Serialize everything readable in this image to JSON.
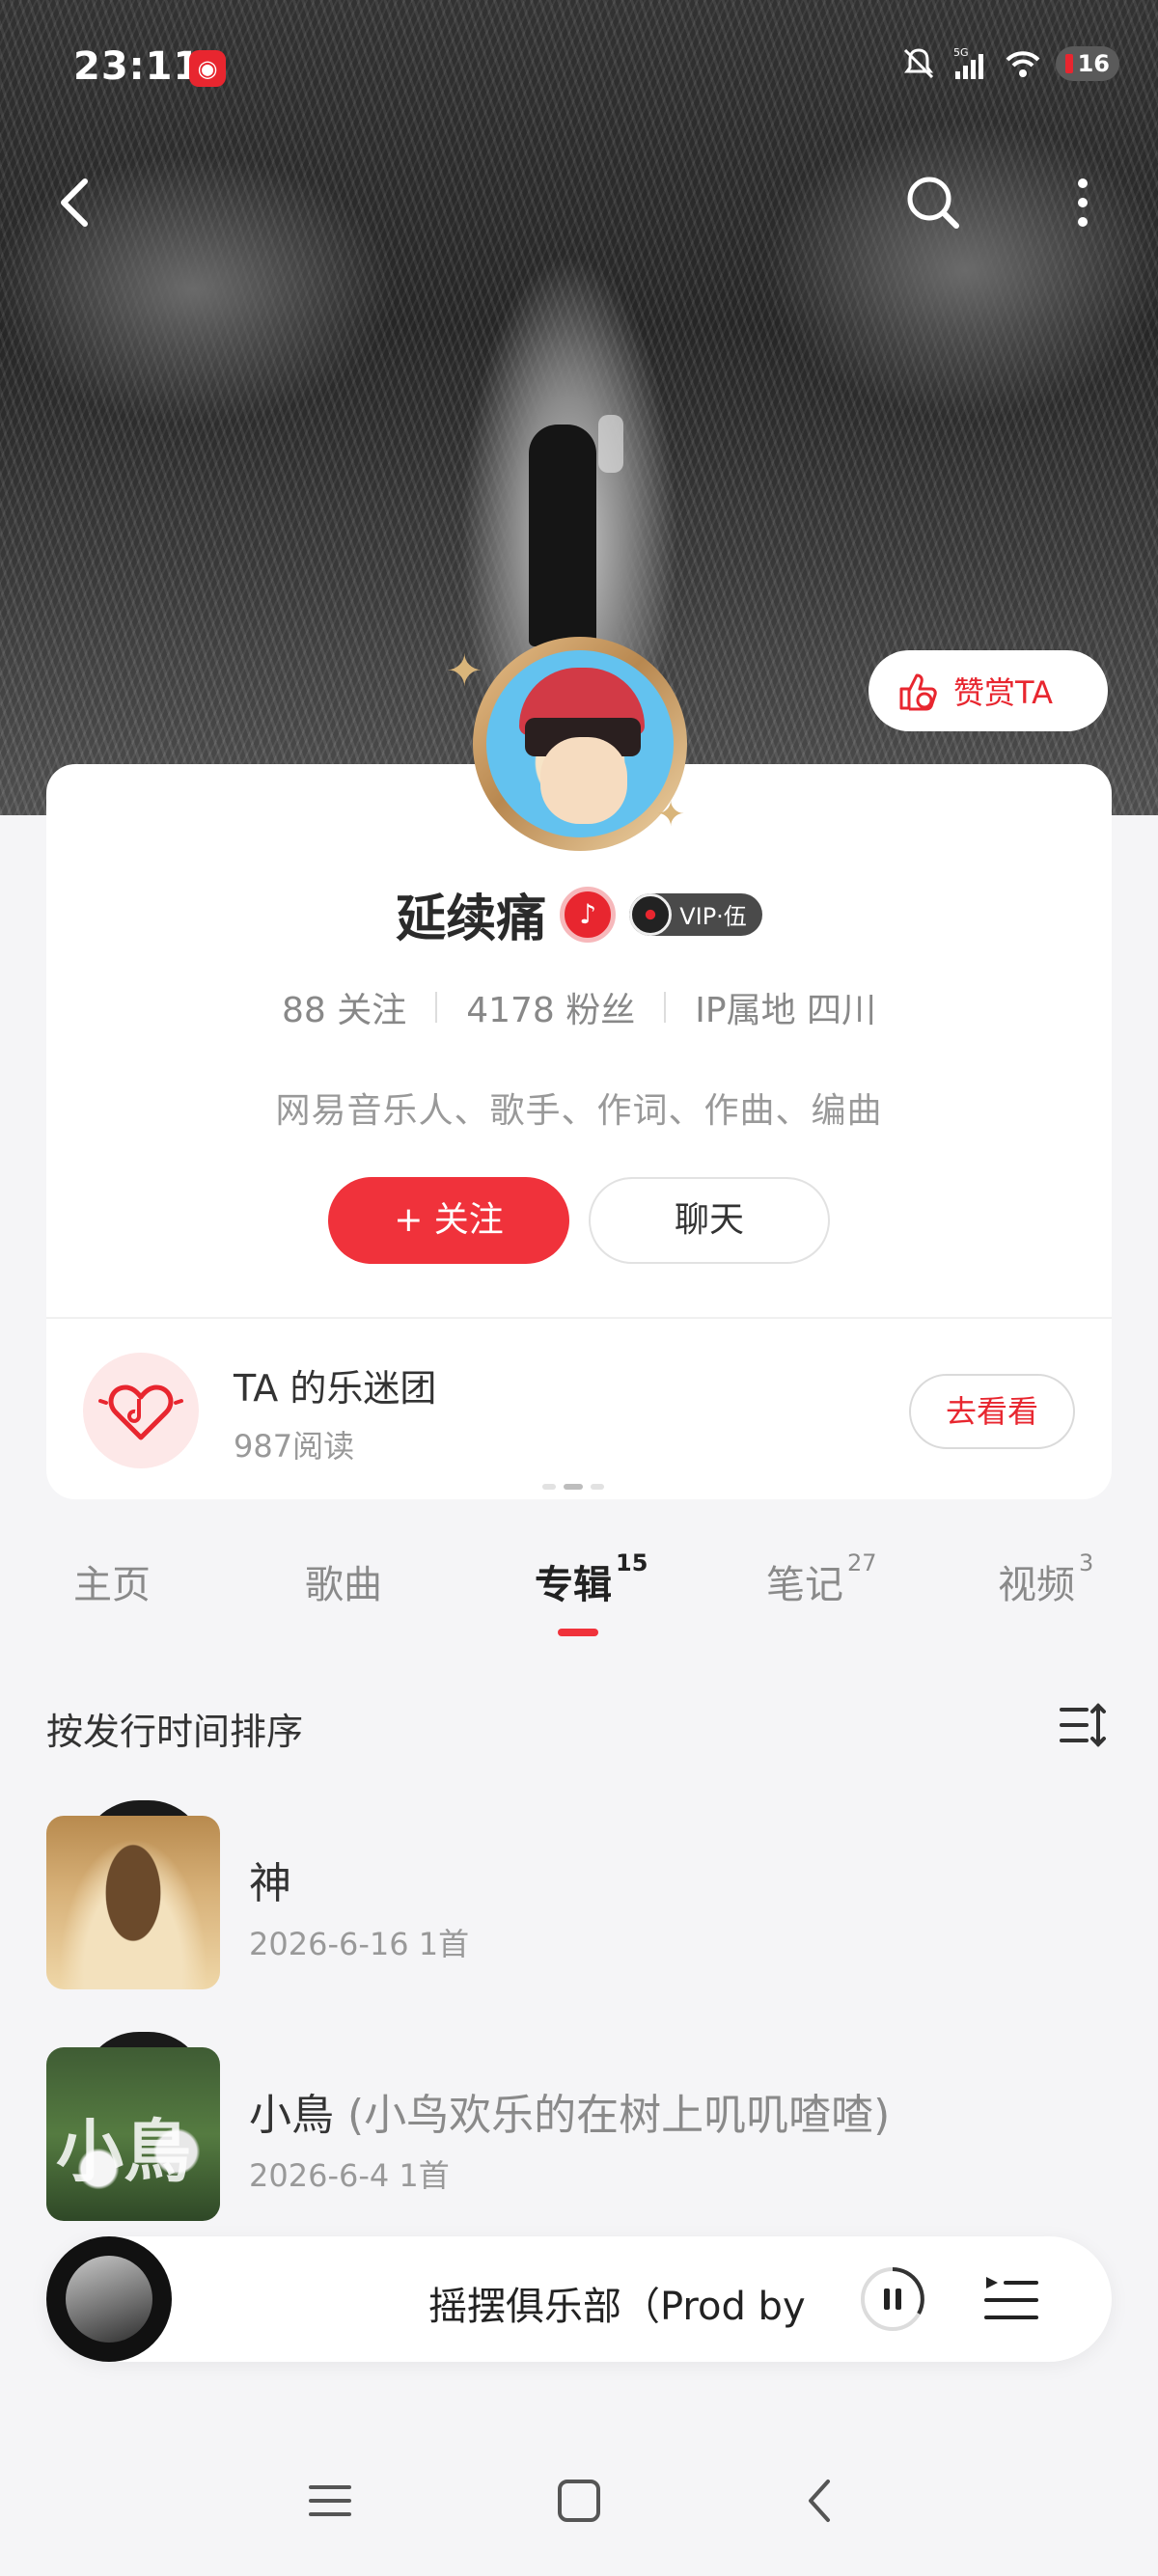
{
  "status_bar": {
    "time": "23:11",
    "network": "5G",
    "battery": "16"
  },
  "header": {
    "reward_label": "赞赏TA"
  },
  "profile": {
    "name": "延续痛",
    "vip_label": "VIP·伍",
    "following": "88 关注",
    "followers": "4178 粉丝",
    "ip_location": "IP属地 四川",
    "bio": "网易音乐人、歌手、作词、作曲、编曲",
    "follow_label": "+ 关注",
    "chat_label": "聊天"
  },
  "fan_club": {
    "title": "TA 的乐迷团",
    "reads": "987阅读",
    "view_label": "去看看"
  },
  "tabs": [
    {
      "label": "主页",
      "count": ""
    },
    {
      "label": "歌曲",
      "count": ""
    },
    {
      "label": "专辑",
      "count": "15"
    },
    {
      "label": "笔记",
      "count": "27"
    },
    {
      "label": "视频",
      "count": "3"
    }
  ],
  "active_tab": "专辑",
  "sort_label": "按发行时间排序",
  "albums": [
    {
      "title": "神",
      "subtitle": "",
      "meta": "2026-6-16 1首"
    },
    {
      "title": "小鳥",
      "subtitle": "(小鸟欢乐的在树上叽叽喳喳)",
      "meta": "2026-6-4 1首",
      "cover_text": "小鳥"
    }
  ],
  "mini_player": {
    "title": "摇摆俱乐部（Prod by"
  },
  "colors": {
    "accent": "#f0323b",
    "text": "#222222",
    "muted": "#999999"
  },
  "icons": [
    "back-icon",
    "search-icon",
    "more-icon",
    "thumbs-up-icon",
    "music-note-icon",
    "vip-disc-icon",
    "fan-heart-icon",
    "sort-icon",
    "pause-icon",
    "playlist-icon",
    "menu-icon",
    "home-icon",
    "back-nav-icon"
  ]
}
